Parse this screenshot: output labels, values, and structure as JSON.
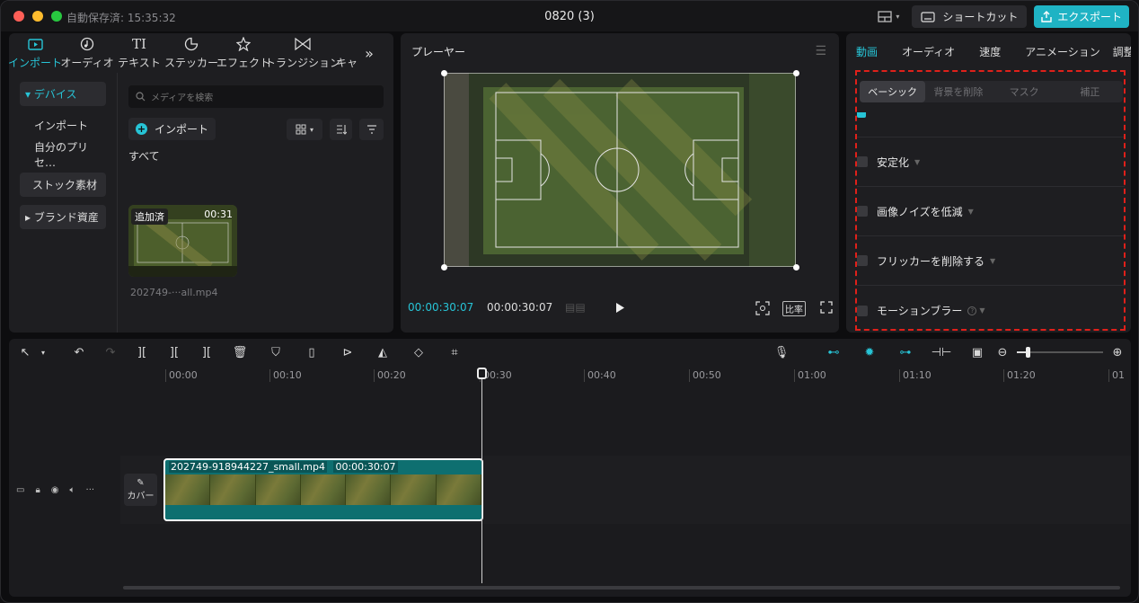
{
  "titlebar": {
    "autosave": "自動保存済: 15:35:32",
    "title": "0820 (3)",
    "shortcut_label": "ショートカット",
    "export_label": "エクスポート",
    "layout_icon": "layout-icon",
    "keyboard_icon": "keyboard-icon",
    "export_icon": "share-icon"
  },
  "toolbar": {
    "items": [
      {
        "label": "インポート",
        "icon": "media-icon",
        "active": true
      },
      {
        "label": "オーディオ",
        "icon": "music-note-icon"
      },
      {
        "label": "テキスト",
        "icon": "text-icon"
      },
      {
        "label": "ステッカー",
        "icon": "sticker-icon"
      },
      {
        "label": "エフェクト",
        "icon": "star-icon"
      },
      {
        "label": "トランジション",
        "icon": "transition-icon"
      },
      {
        "label": "キャ",
        "icon": ""
      }
    ],
    "more_icon": "chevron-double-right-icon"
  },
  "sidebar": {
    "items": [
      {
        "label": "▾ デバイス"
      },
      {
        "label": "インポート"
      },
      {
        "label": "自分のプリセ…"
      },
      {
        "label": "ストック素材"
      },
      {
        "label": "▸ ブランド資産"
      }
    ]
  },
  "media": {
    "search_placeholder": "メディアを検索",
    "import_label": "インポート",
    "section_label": "すべて",
    "thumb_badge": "追加済",
    "thumb_duration": "00:31",
    "thumb_filename": "202749-···all.mp4"
  },
  "player": {
    "title": "プレーヤー",
    "current_time": "00:00:30:07",
    "total_time": "00:00:30:07",
    "ratio_label": "比率"
  },
  "properties": {
    "tabs": [
      "動画",
      "オーディオ",
      "速度",
      "アニメーション",
      "調整"
    ],
    "subtabs": [
      "ベーシック",
      "背景を削除",
      "マスク",
      "補正"
    ],
    "options": [
      "安定化",
      "画像ノイズを低減",
      "フリッカーを削除する",
      "モーションブラー"
    ]
  },
  "timeline": {
    "ticks": [
      "00:00",
      "00:10",
      "00:20",
      "00:30",
      "00:40",
      "00:50",
      "01:00",
      "01:10",
      "01:20",
      "01"
    ],
    "clip_name": "202749-918944227_small.mp4",
    "clip_duration": "00:00:30:07",
    "cover_label": "カバー"
  },
  "colors": {
    "accent": "#27c4d6",
    "export": "#1fb3c4",
    "highlight": "#e0201a",
    "clip": "#0e6f70"
  }
}
